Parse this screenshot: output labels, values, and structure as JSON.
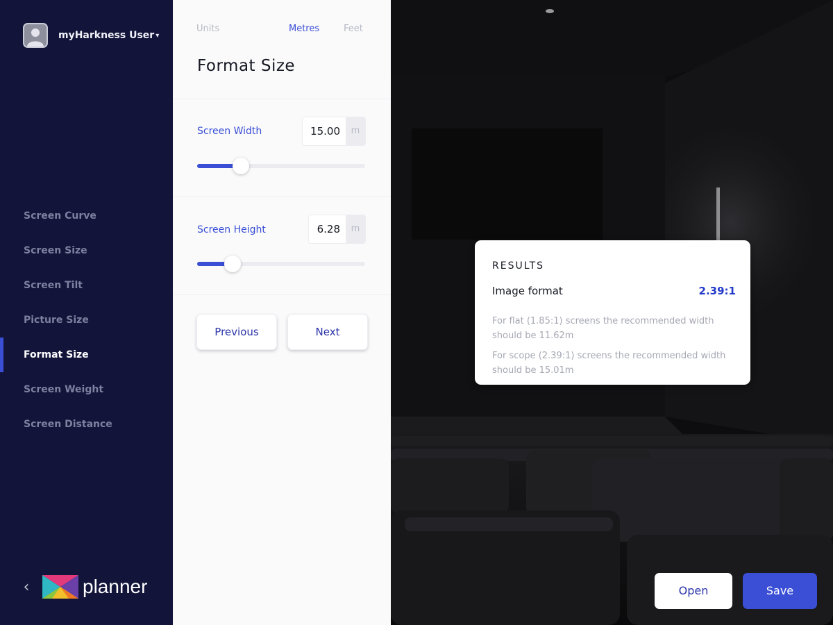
{
  "user": {
    "name": "myHarkness User",
    "caret": "▾"
  },
  "nav": {
    "items": [
      {
        "label": "Screen Curve"
      },
      {
        "label": "Screen Size"
      },
      {
        "label": "Screen Tilt"
      },
      {
        "label": "Picture Size"
      },
      {
        "label": "Format Size",
        "active": true
      },
      {
        "label": "Screen Weight"
      },
      {
        "label": "Screen Distance"
      }
    ],
    "back_icon": "chevron-left-icon"
  },
  "logo": {
    "text": "planner"
  },
  "panel": {
    "units": {
      "label": "Units",
      "options": [
        "Metres",
        "Feet"
      ],
      "selected": "Metres"
    },
    "title": "Format Size",
    "screen_width": {
      "label": "Screen Width",
      "value": "15.00",
      "unit": "m",
      "slider_fraction": 0.26
    },
    "screen_height": {
      "label": "Screen Height",
      "value": "6.28",
      "unit": "m",
      "slider_fraction": 0.21
    },
    "buttons": {
      "previous": "Previous",
      "next": "Next"
    }
  },
  "results": {
    "heading": "RESULTS",
    "format_label": "Image format",
    "format_value": "2.39:1",
    "note_flat": "For flat (1.85:1) screens the recommended width should be 11.62m",
    "note_scope": "For scope (2.39:1) screens the recommended width should be 15.01m"
  },
  "actions": {
    "open": "Open",
    "save": "Save"
  },
  "colors": {
    "accent": "#3a4fd6",
    "sidebar": "#12143a",
    "panel": "#fafafb"
  }
}
